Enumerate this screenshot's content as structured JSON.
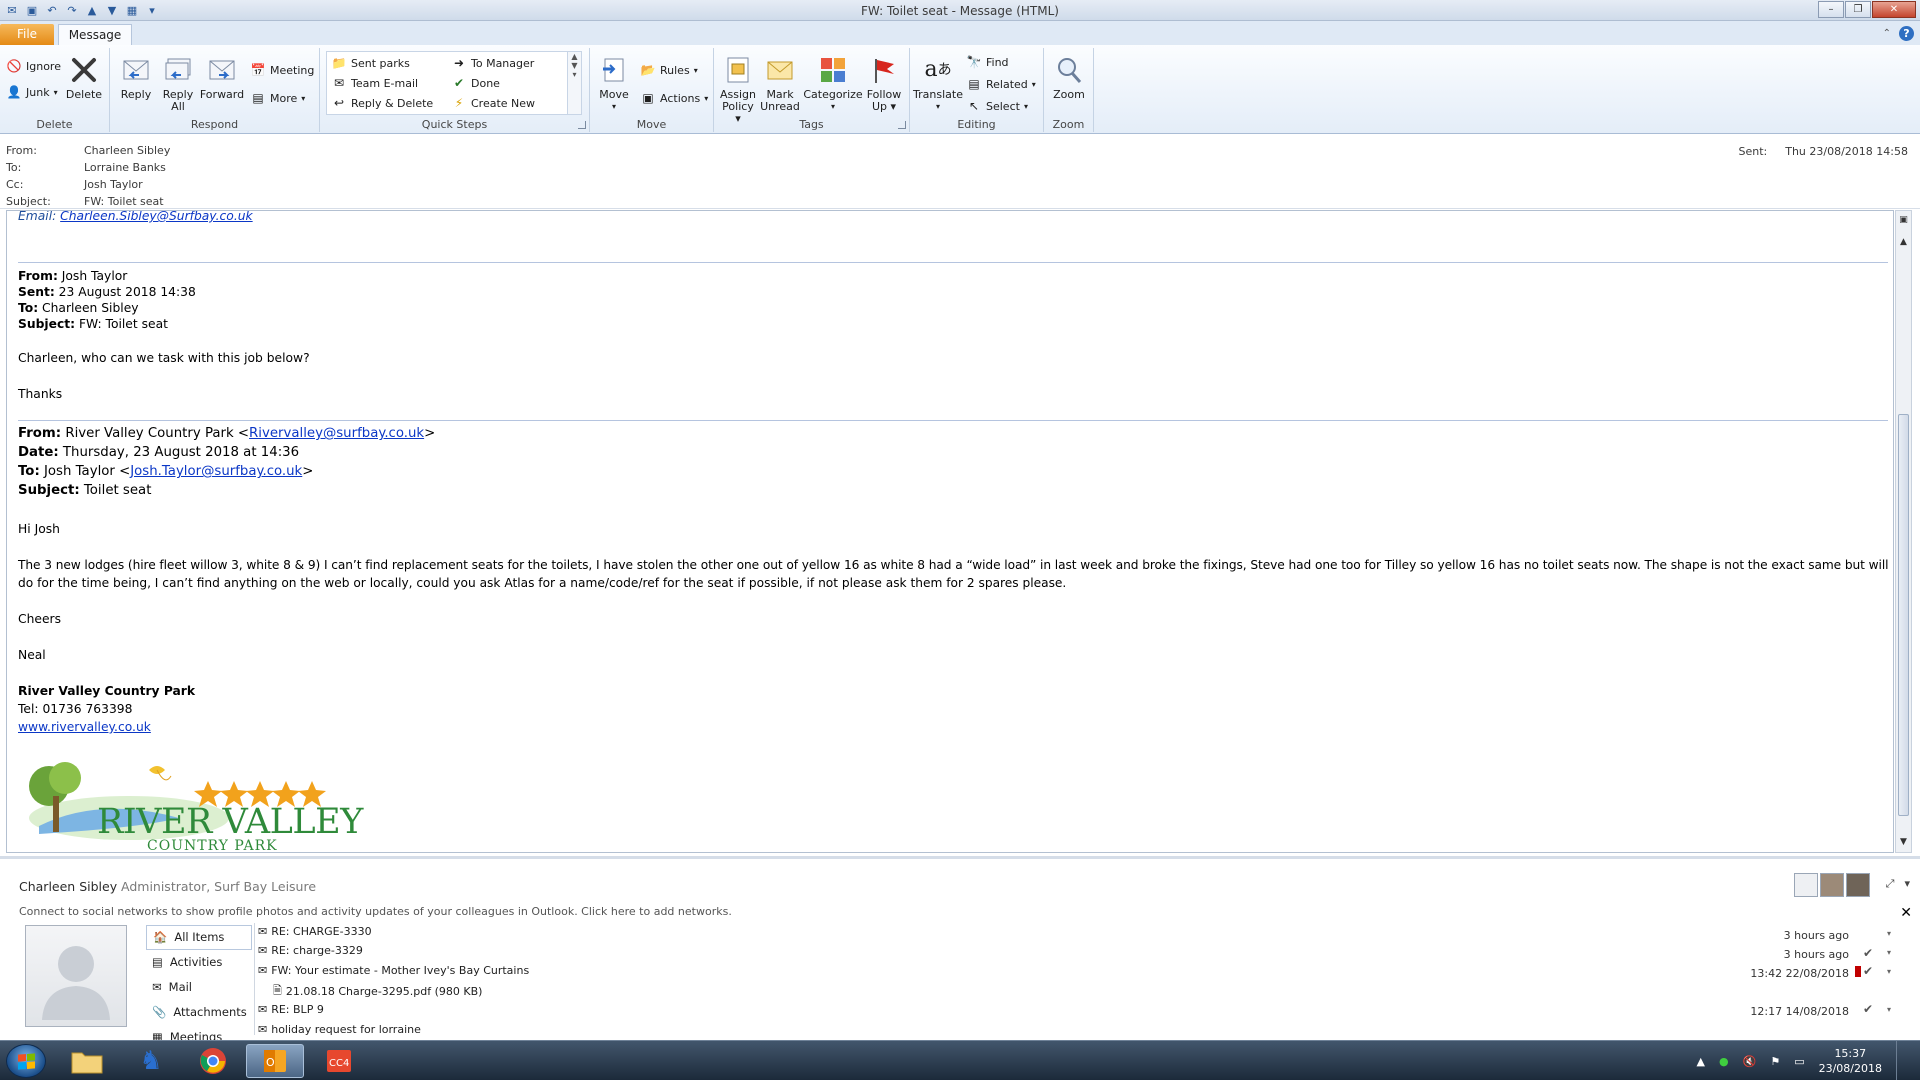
{
  "window": {
    "title": "FW: Toilet seat - Message (HTML)"
  },
  "tabs": {
    "file": "File",
    "message": "Message"
  },
  "ribbon": {
    "delete": {
      "ignore": "Ignore",
      "junk": "Junk",
      "delete": "Delete",
      "label": "Delete"
    },
    "respond": {
      "reply": "Reply",
      "reply_all_1": "Reply",
      "reply_all_2": "All",
      "forward": "Forward",
      "meeting": "Meeting",
      "more": "More",
      "label": "Respond"
    },
    "quick_steps": {
      "items": [
        "Sent parks",
        "To Manager",
        "Team E-mail",
        "Done",
        "Reply & Delete",
        "Create New"
      ],
      "label": "Quick Steps"
    },
    "move": {
      "move": "Move",
      "rules": "Rules",
      "actions": "Actions",
      "label": "Move"
    },
    "tags": {
      "assign_1": "Assign",
      "assign_2": "Policy",
      "mark_1": "Mark",
      "mark_2": "Unread",
      "categorize": "Categorize",
      "follow_1": "Follow",
      "follow_2": "Up",
      "label": "Tags"
    },
    "editing": {
      "translate": "Translate",
      "find": "Find",
      "related": "Related",
      "select": "Select",
      "label": "Editing"
    },
    "zoom": {
      "zoom": "Zoom",
      "label": "Zoom"
    }
  },
  "header": {
    "from_label": "From:",
    "from": "Charleen Sibley",
    "to_label": "To:",
    "to": "Lorraine Banks",
    "cc_label": "Cc:",
    "cc": "Josh Taylor",
    "subject_label": "Subject:",
    "subject": "FW: Toilet seat",
    "sent_label": "Sent:",
    "sent": "Thu 23/08/2018 14:58"
  },
  "body": {
    "email_line_label": "Email: ",
    "email_line_link": "Charleen.Sibley@Surfbay.co.uk",
    "fwd1": {
      "from_label": "From:",
      "from": " Josh Taylor",
      "sent_label": "Sent:",
      "sent": " 23 August 2018 14:38",
      "to_label": "To:",
      "to": " Charleen Sibley",
      "subject_label": "Subject:",
      "subject": " FW: Toilet seat"
    },
    "line_question": "Charleen, who can we task with this job below?",
    "line_thanks": "Thanks",
    "fwd2": {
      "from_label": "From:",
      "from_name": " River Valley Country Park <",
      "from_link": "Rivervalley@surfbay.co.uk",
      "from_end": ">",
      "date_label": "Date:",
      "date": " Thursday, 23 August 2018 at 14:36",
      "to_label": "To:",
      "to_name": " Josh Taylor <",
      "to_link": "Josh.Taylor@surfbay.co.uk",
      "to_end": ">",
      "subject_label": "Subject:",
      "subject": " Toilet seat"
    },
    "greeting": "Hi Josh",
    "para_1": "The 3 new lodges (hire fleet willow 3, white 8 & 9) I can’t find replacement seats for the toilets, I have stolen the other one out of yellow 16 as white 8 had a “wide load” in last week and broke the fixings, Steve had one too for Tilley so yellow 16 has no toilet seats now. The shape is not the exact same but will",
    "para_2": "do for the time being, I can’t find anything on the web or locally, could you ask Atlas for a name/code/ref for the seat if possible, if not please ask them for 2 spares please.",
    "cheers": "Cheers",
    "sign": "Neal",
    "sig_org": "River Valley Country Park",
    "sig_tel": "Tel: 01736 763398",
    "sig_web": "www.rivervalley.co.uk",
    "logo_text_1": "RIVER VALLEY",
    "logo_text_2": "COUNTRY PARK"
  },
  "people_pane": {
    "name": "Charleen Sibley",
    "role": "Administrator, Surf Bay Leisure",
    "social_note": "Connect to social networks to show profile photos and activity updates of your colleagues in Outlook. Click here to add networks.",
    "nav": [
      "All Items",
      "Activities",
      "Mail",
      "Attachments",
      "Meetings"
    ],
    "items": [
      {
        "subject": "RE: CHARGE-3330",
        "time": "3 hours ago"
      },
      {
        "subject": "RE: charge-3329",
        "time": "3 hours ago"
      },
      {
        "subject": "FW: Your estimate - Mother Ivey's Bay Curtains",
        "time": "13:42  22/08/2018"
      },
      {
        "subject": "21.08.18 Charge-3295.pdf (980 KB)",
        "time": ""
      },
      {
        "subject": "RE: BLP 9",
        "time": "12:17  14/08/2018"
      },
      {
        "subject": "holiday request for lorraine",
        "time": ""
      }
    ]
  },
  "taskbar": {
    "time": "15:37",
    "date": "23/08/2018"
  },
  "colors": {
    "link": "#0b37c6",
    "ribbon_bg": "#e4edf8",
    "file_tab": "#e48a16",
    "flag_red": "#c00000"
  }
}
